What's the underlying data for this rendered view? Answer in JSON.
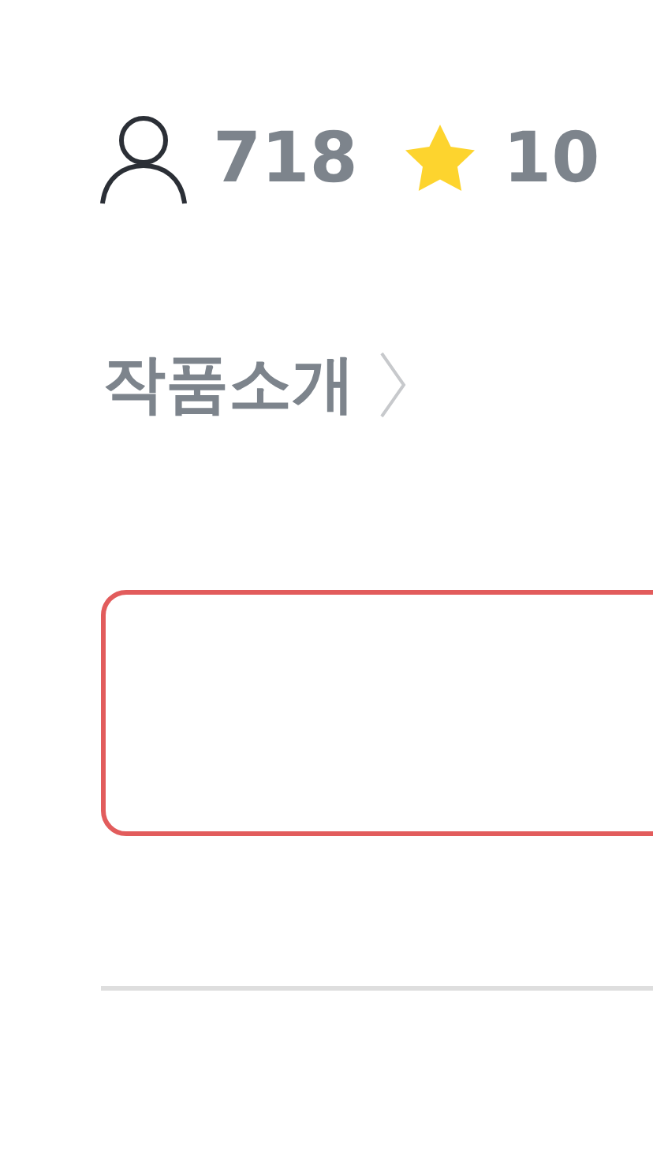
{
  "stats": {
    "views": "718",
    "rating": "10"
  },
  "section_link": {
    "label": "작품소개"
  }
}
